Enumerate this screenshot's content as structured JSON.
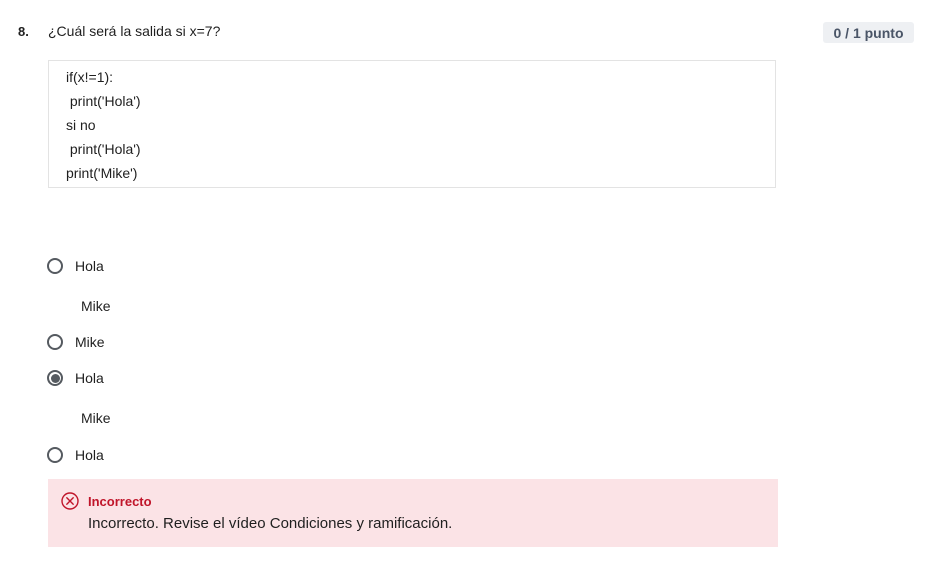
{
  "question": {
    "number": "8.",
    "text": "¿Cuál será la salida si x=7?",
    "score": "0 / 1 punto"
  },
  "code_lines": [
    "if(x!=1):",
    " print('Hola')",
    "si no",
    " print('Hola')",
    "print('Mike')"
  ],
  "options": [
    {
      "label": "Hola",
      "continuation": "Mike",
      "selected": false
    },
    {
      "label": "Mike",
      "continuation": "",
      "selected": false
    },
    {
      "label": "Hola",
      "continuation": "Mike",
      "selected": true
    },
    {
      "label": "Hola",
      "continuation": "",
      "selected": false
    }
  ],
  "feedback": {
    "title": "Incorrecto",
    "text": "Incorrecto. Revise el vídeo Condiciones y ramificación.",
    "color": "#c0152a",
    "background": "#fbe3e6"
  }
}
